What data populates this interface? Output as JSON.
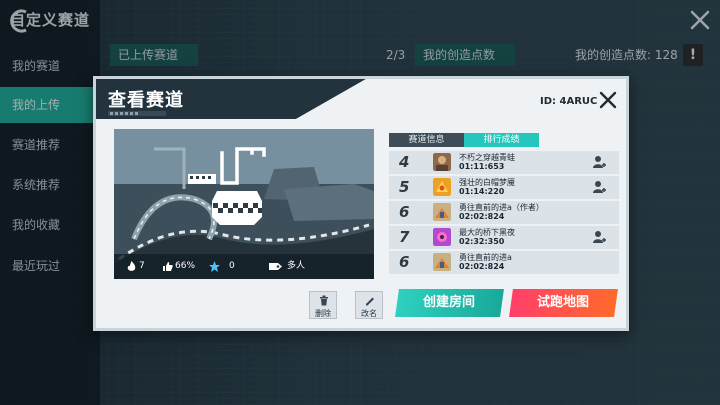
{
  "app": {
    "title": "自定义赛道"
  },
  "sidebar": {
    "items": [
      {
        "label": "我的赛道"
      },
      {
        "label": "我的上传"
      },
      {
        "label": "赛道推荐"
      },
      {
        "label": "系统推荐"
      },
      {
        "label": "我的收藏"
      },
      {
        "label": "最近玩过"
      }
    ],
    "active_index": 1
  },
  "topbar": {
    "uploaded_tab": "已上传赛道",
    "uploaded_count": "2/3",
    "points_tab": "我的创造点数",
    "points_label": "我的创造点数: 128",
    "alert_glyph": "!"
  },
  "dialog": {
    "title": "查看赛道",
    "track_id": "ID: 4ARUC",
    "stats": {
      "fire": "7",
      "like": "66%",
      "star": "0",
      "mode": "多人"
    },
    "tabs": {
      "info": "赛道信息",
      "ranking": "排行成绩"
    },
    "leaderboard": [
      {
        "rank": "4",
        "name": "不朽之穿越青蛙",
        "time": "01:11:653",
        "add": true,
        "avatar_color": "#8a6a4a"
      },
      {
        "rank": "5",
        "name": "强壮的白帽梦魇",
        "time": "01:14:220",
        "add": true,
        "avatar_color": "#f0a020"
      },
      {
        "rank": "6",
        "name": "勇往直前的进a（作者）",
        "time": "02:02:824",
        "add": false,
        "avatar_color": "#d8a050"
      },
      {
        "rank": "7",
        "name": "最大的桥下黑夜",
        "time": "02:32:350",
        "add": true,
        "avatar_color": "#b04ad0"
      },
      {
        "rank": "6",
        "name": "勇往直前的进a",
        "time": "02:02:824",
        "add": false,
        "avatar_color": "#d8a050"
      }
    ],
    "buttons": {
      "delete": "删除",
      "rename": "改名",
      "create_room": "创建房间",
      "test_map": "试跑地图"
    }
  },
  "colors": {
    "accent_teal": "#25c6bb",
    "accent_red": "#ff3f6a",
    "sidebar_active": "#1fb59f"
  }
}
